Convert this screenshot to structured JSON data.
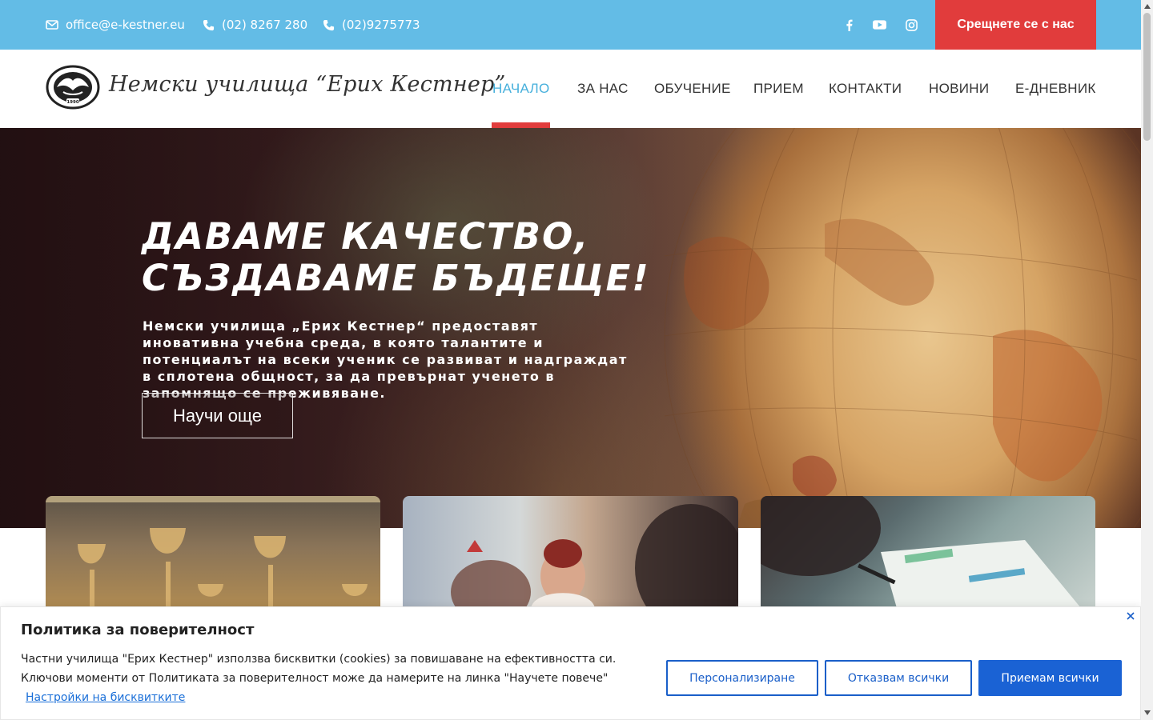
{
  "topbar": {
    "email": "office@e-kestner.eu",
    "phone1": "(02) 8267 280",
    "phone2": "(02)9275773",
    "social_icons": [
      "facebook-icon",
      "youtube-icon",
      "instagram-icon"
    ],
    "cta_label": "Срещнете се с нас",
    "bg_color": "#63bce6",
    "cta_color": "#e13c3c"
  },
  "header": {
    "logo_text": "Немски училища “Ерих Кестнер”",
    "logo_emblem_text": "1990",
    "nav": [
      "НАЧАЛО",
      "ЗА НАС",
      "ОБУЧЕНИЕ",
      "ПРИЕМ",
      "КОНТАКТИ",
      "НОВИНИ",
      "Е-ДНЕВНИК"
    ],
    "active_index": 0,
    "active_color": "#47b0dc"
  },
  "hero": {
    "title_line1": "ДАВАМЕ КАЧЕСТВО,",
    "title_line2": "СЪЗДАВАМЕ БЪДЕЩЕ!",
    "text": "Немски училища „Ерих Кестнер“ предоставят иновативна учебна среда, в която талантите и потенциалът на всеки ученик се развиват и надграждат в сплотена общност, за да превърнат ученето в запомнящо се преживяване.",
    "button_label": "Научи още"
  },
  "cookie": {
    "title": "Политика за поверителност",
    "text": "Частни училища \"Ерих Кестнер\" използва бисквитки (cookies) за повишаване на ефективността си. Ключови моменти от Политиката за поверителност може да намерите на линка \"Научете повече\"",
    "link_label": "Настройки на бисквитките",
    "btn_customize": "Персонализиране",
    "btn_reject": "Отказвам всички",
    "btn_accept": "Приемам всички",
    "accent_color": "#1a62d4"
  }
}
